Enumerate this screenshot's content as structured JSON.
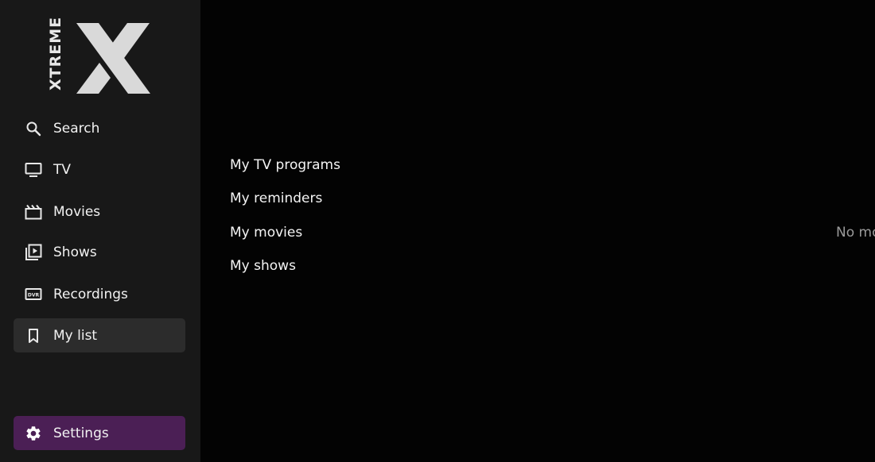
{
  "brand": {
    "word": "XTREME",
    "letter": "X"
  },
  "sidebar": {
    "items": [
      {
        "label": "Search",
        "icon": "search-icon"
      },
      {
        "label": "TV",
        "icon": "tv-icon"
      },
      {
        "label": "Movies",
        "icon": "clapperboard-icon"
      },
      {
        "label": "Shows",
        "icon": "play-library-icon"
      },
      {
        "label": "Recordings",
        "icon": "dvr-icon"
      },
      {
        "label": "My list",
        "icon": "bookmark-icon"
      }
    ],
    "active_item": "My list",
    "settings": {
      "label": "Settings",
      "icon": "gear-icon"
    }
  },
  "mylist": {
    "categories": [
      {
        "label": "My TV programs"
      },
      {
        "label": "My reminders"
      },
      {
        "label": "My movies"
      },
      {
        "label": "My shows"
      }
    ]
  },
  "empty_state": {
    "text": "No mo"
  },
  "colors": {
    "background": "#030303",
    "sidebar": "#181818",
    "active_item": "#2c2c2c",
    "settings_accent": "#4b1f55",
    "text": "#f2f2f2",
    "muted_text": "#9a9a9a"
  }
}
